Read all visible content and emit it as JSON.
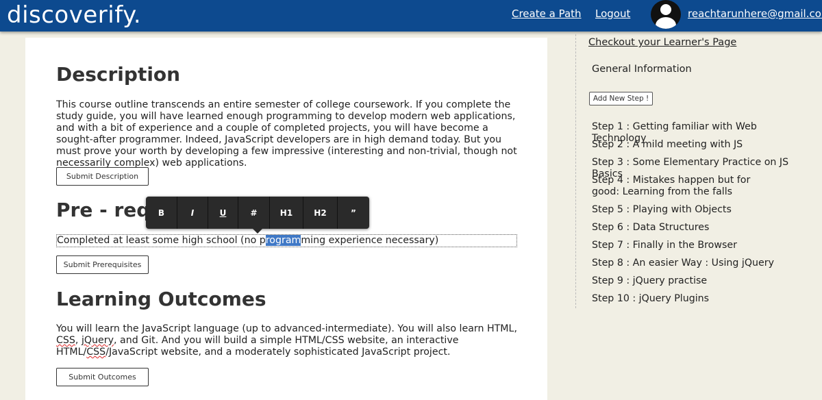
{
  "header": {
    "logo": "discoverify.",
    "create_path": "Create a Path",
    "logout": "Logout",
    "user_email": "reachtarunhere@gmail.com"
  },
  "description": {
    "title": "Description",
    "text": "This course outline transcends an entire semester of college coursework. If you complete the study guide, you will have learned enough programming to develop modern web applications, and with a bit of experience and a couple of completed projects, you will have become a sought-after programmer. Indeed, JavaScript developers are in high demand today. But you must prove your worth by developing a few impressive (interesting and non-trivial, though not necessarily complex) web applications.",
    "button": "Submit Description"
  },
  "prerequisites": {
    "title": "Pre - requisites",
    "text_before": "Completed at least some high school (no p",
    "text_selected": "rogram",
    "text_after": "ming experience necessary)",
    "button": "Submit Prerequisites"
  },
  "toolbar": [
    "B",
    "I",
    "U",
    "#",
    "H1",
    "H2",
    "”"
  ],
  "outcomes": {
    "title": "Learning Outcomes",
    "text_1": "You will learn the JavaScript language (up to advanced-intermediate). You will also learn HTML, ",
    "css_1": "CSS",
    "text_2": ", ",
    "jquery": "jQuery",
    "text_3": ", and Git. And you will build a simple HTML/CSS website, an interactive HTML/",
    "css_2": "CSS",
    "text_4": "/JavaScript website, and a moderately sophisticated JavaScript project.",
    "button": "Submit Outcomes"
  },
  "sidebar": {
    "learner_link": "Checkout your Learner's Page",
    "general_info": "General Information",
    "add_step": "Add New Step !",
    "steps": [
      "Step 1 : Getting familiar with Web Technology",
      "Step 2 : A mild meeting with JS",
      "Step 3 : Some Elementary Practice on JS Basics",
      "Step 4 : Mistakes happen but for good: Learning from the falls",
      "Step 5 : Playing with Objects",
      "Step 6 : Data Structures",
      "Step 7 : Finally in the Browser",
      "Step 8 : An easier Way : Using jQuery",
      "Step 9 : jQuery practise",
      "Step 10 : jQuery Plugins"
    ]
  }
}
